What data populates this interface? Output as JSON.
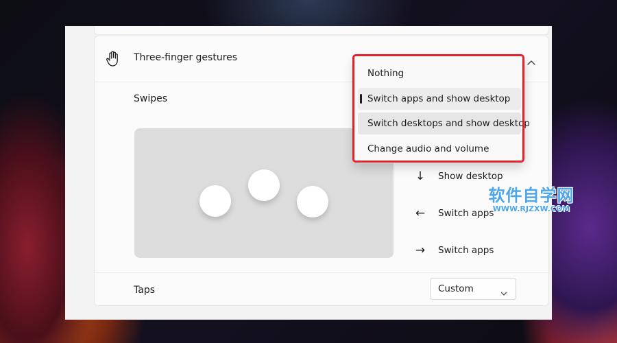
{
  "section": {
    "title": "Three-finger gestures",
    "icon": "hand-icon"
  },
  "swipes": {
    "label": "Swipes",
    "dropdown": {
      "options": [
        {
          "label": "Nothing",
          "state": "normal"
        },
        {
          "label": "Switch apps and show desktop",
          "state": "selected"
        },
        {
          "label": "Switch desktops and show desktop",
          "state": "hovered"
        },
        {
          "label": "Change audio and volume",
          "state": "normal"
        }
      ],
      "selected_value": "Switch apps and show desktop"
    },
    "gestures": [
      {
        "icon": "arrow-down-icon",
        "label": "Show desktop"
      },
      {
        "icon": "arrow-left-icon",
        "label": "Switch apps"
      },
      {
        "icon": "arrow-right-icon",
        "label": "Switch apps"
      }
    ]
  },
  "taps": {
    "label": "Taps",
    "select_value": "Custom"
  },
  "watermark": {
    "text": "软件自学网",
    "url": "WWW.RJZXW.COM"
  },
  "colors": {
    "highlight": "#e0232b",
    "watermark": "#4fa6e8"
  }
}
